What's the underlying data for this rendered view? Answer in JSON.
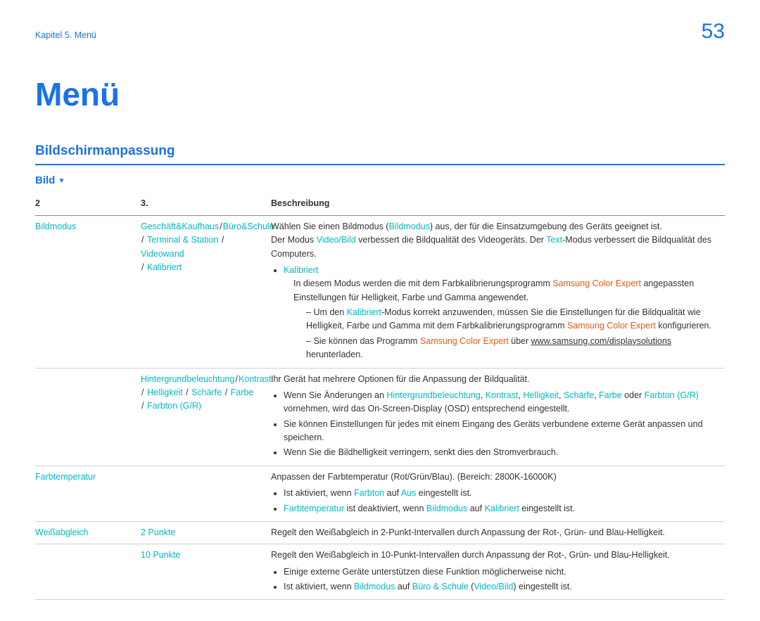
{
  "chapter": "Kapitel 5. Menü",
  "page_number": "53",
  "title": "Menü",
  "section": "Bildschirmanpassung",
  "sub_heading": "Bild",
  "table_headers": {
    "c1": "2",
    "c2": "3.",
    "c3": "Beschreibung"
  },
  "rows": {
    "bildmodus": {
      "col1": "Bildmodus",
      "col2_parts": {
        "a": "Geschäft&Kaufhaus",
        "b": "Büro&Schule",
        "c": "Terminal & Station",
        "d": "Videowand",
        "e": "Kalibriert"
      },
      "desc": {
        "line1_pre": "Wählen Sie einen Bildmodus (",
        "line1_link": "Bildmodus",
        "line1_post": ") aus, der für die Einsatzumgebung des Geräts geeignet ist.",
        "line2_a": "Der Modus ",
        "line2_b": "Video/Bild",
        "line2_c": " verbessert die Bildqualität des Videogeräts.  Der ",
        "line2_d": "Text",
        "line2_e": "-Modus verbessert die Bildqualität des Computers.",
        "bullet_header": "Kalibriert",
        "para1_a": "In diesem Modus werden die mit dem Farbkalibrierungsprogramm ",
        "para1_b": "Samsung Color Expert",
        "para1_c": " angepassten Einstellungen für Helligkeit, Farbe und Gamma angewendet.",
        "dash1_a": "Um den ",
        "dash1_b": "Kalibriert",
        "dash1_c": "-Modus korrekt anzuwenden, müssen Sie die Einstellungen für die Bildqualität wie Helligkeit, Farbe und Gamma mit dem Farbkalibrierungsprogramm ",
        "dash1_d": "Samsung Color Expert",
        "dash1_e": " konfigurieren.",
        "dash2_a": "Sie können das Programm ",
        "dash2_b": "Samsung Color Expert",
        "dash2_c": " über ",
        "dash2_link": "www.samsung.com/displaysolutions",
        "dash2_d": " herunterladen."
      }
    },
    "hgb": {
      "col2_parts": {
        "a": "Hintergrundbeleuchtung",
        "b": "Kontrast",
        "c": "Helligkeit",
        "d": "Schärfe",
        "e": "Farbe",
        "f": "Farbton (G/R)"
      },
      "line1": "Ihr Gerät hat mehrere Optionen für die Anpassung der Bildqualität.",
      "b1_a": "Wenn Sie Änderungen an ",
      "b1_items": {
        "a": "Hintergrundbeleuchtung",
        "b": "Kontrast",
        "c": "Helligkeit",
        "d": "Schärfe",
        "e": "Farbe",
        "f": "Farbton (G/R)"
      },
      "b1_oder": " oder ",
      "b1_z": " vornehmen, wird das On-Screen-Display (OSD) entsprechend eingestellt.",
      "b2": "Sie können Einstellungen für jedes mit einem Eingang des Geräts verbundene externe Gerät anpassen und speichern.",
      "b3": "Wenn Sie die Bildhelligkeit verringern, senkt dies den Stromverbrauch."
    },
    "farbtemp": {
      "col1": "Farbtemperatur",
      "line1": "Anpassen der Farbtemperatur (Rot/Grün/Blau). (Bereich: 2800K-16000K)",
      "b1_a": "Ist aktiviert, wenn ",
      "b1_b": "Farbton",
      "b1_c": " auf ",
      "b1_d": "Aus",
      "b1_e": " eingestellt ist.",
      "b2_a": "Farbtemperatur",
      "b2_b": " ist deaktiviert, wenn ",
      "b2_c": "Bildmodus",
      "b2_d": " auf ",
      "b2_e": "Kalibriert",
      "b2_f": " eingestellt ist."
    },
    "weiss_2": {
      "col1": "Weißabgleich",
      "col2": "2 Punkte",
      "line1": "Regelt den Weißabgleich in 2-Punkt-Intervallen durch Anpassung der Rot-, Grün- und Blau-Helligkeit."
    },
    "weiss_10": {
      "col2": "10 Punkte",
      "line1": "Regelt den Weißabgleich in 10-Punkt-Intervallen durch Anpassung der Rot-, Grün- und Blau-Helligkeit.",
      "b1": "Einige externe Geräte unterstützen diese Funktion möglicherweise nicht.",
      "b2_a": "Ist aktiviert, wenn ",
      "b2_b": "Bildmodus",
      "b2_c": " auf ",
      "b2_d": "Büro & Schule",
      "b2_e": " (",
      "b2_f": "Video/Bild",
      "b2_g": ") eingestellt ist."
    }
  }
}
